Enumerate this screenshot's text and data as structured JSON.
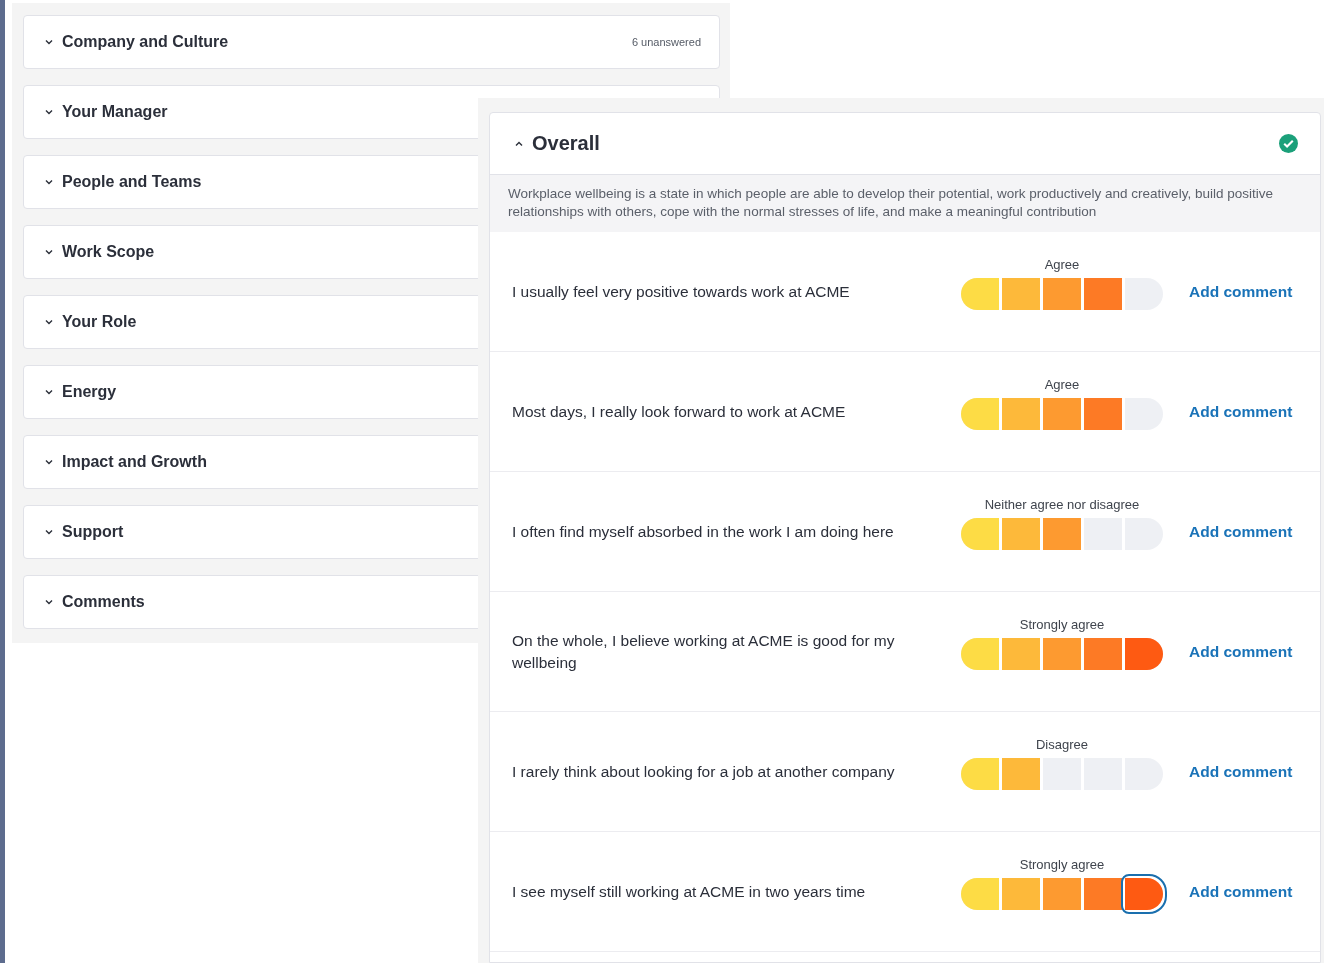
{
  "sections": [
    {
      "title": "Company and Culture",
      "expanded": false,
      "status": "6 unanswered"
    },
    {
      "title": "Your Manager",
      "expanded": false
    },
    {
      "title": "People and Teams",
      "expanded": false
    },
    {
      "title": "Work Scope",
      "expanded": false
    },
    {
      "title": "Your Role",
      "expanded": false
    },
    {
      "title": "Energy",
      "expanded": false
    },
    {
      "title": "Impact and Growth",
      "expanded": false
    },
    {
      "title": "Support",
      "expanded": false
    },
    {
      "title": "Comments",
      "expanded": false
    }
  ],
  "overlay": {
    "title": "Overall",
    "expanded": true,
    "complete": true,
    "description": "Workplace wellbeing is a state in which people are able to develop their potential, work productively and creatively, build positive relationships with others, cope with the normal stresses of life, and make a meaningful contribution",
    "questions": [
      {
        "text": "I usually feel very positive towards work at ACME",
        "answer": "Agree",
        "level": 0.8,
        "focused": false,
        "action": "Add comment"
      },
      {
        "text": "Most days, I really look forward to work at ACME",
        "answer": "Agree",
        "level": 0.8,
        "focused": false,
        "action": "Add comment"
      },
      {
        "text": "I often find myself absorbed in the work I am doing here",
        "answer": "Neither agree nor disagree",
        "level": 0.6,
        "focused": false,
        "action": "Add comment"
      },
      {
        "text": "On the whole, I believe working at ACME is good for my wellbeing",
        "answer": "Strongly agree",
        "level": 1,
        "focused": false,
        "action": "Add comment"
      },
      {
        "text": "I rarely think about looking for a job at another company",
        "answer": "Disagree",
        "level": 0.4,
        "focused": false,
        "action": "Add comment"
      },
      {
        "text": "I see myself still working at ACME in two years time",
        "answer": "Strongly agree",
        "level": 1,
        "focused": true,
        "action": "Add comment"
      }
    ]
  }
}
